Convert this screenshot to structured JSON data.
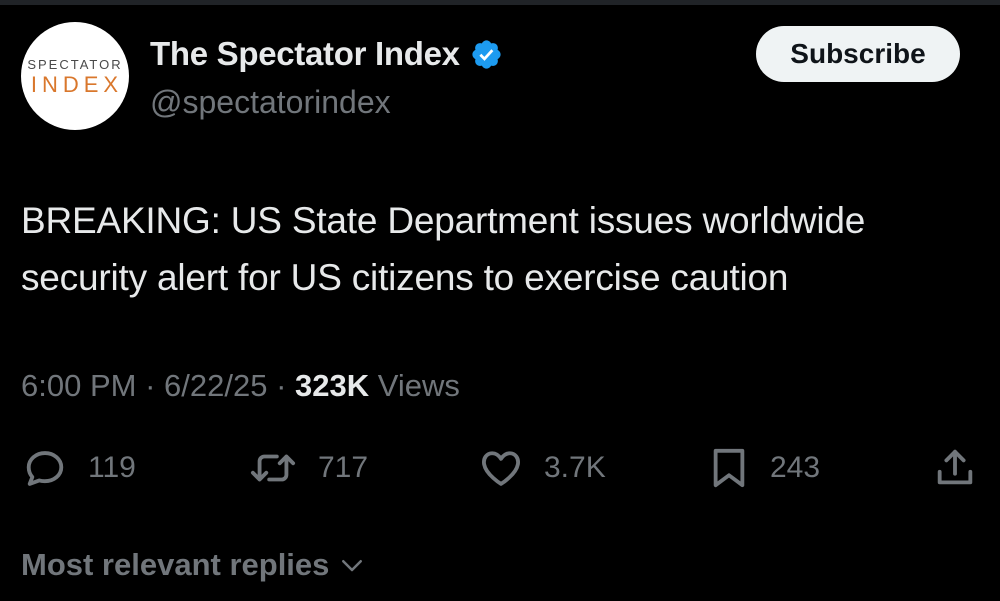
{
  "author": {
    "avatar_line1": "SPECTATOR",
    "avatar_line2": "INDEX",
    "display_name": "The Spectator Index",
    "handle": "@spectatorindex",
    "verified_icon": "verified-badge-icon",
    "verified_color": "#1d9bf0"
  },
  "subscribe_label": "Subscribe",
  "tweet": {
    "text": "BREAKING: US State Department issues worldwide security alert for US citizens to exercise caution"
  },
  "meta": {
    "time": "6:00 PM",
    "separator": " · ",
    "date": "6/22/25",
    "views_count": "323K",
    "views_label": " Views"
  },
  "actions": {
    "replies": {
      "icon": "reply-icon",
      "count": "119"
    },
    "reposts": {
      "icon": "repost-icon",
      "count": "717"
    },
    "likes": {
      "icon": "heart-icon",
      "count": "3.7K"
    },
    "bookmarks": {
      "icon": "bookmark-icon",
      "count": "243"
    },
    "share": {
      "icon": "share-icon"
    }
  },
  "replies_sort": {
    "label": "Most relevant replies",
    "icon": "chevron-down-icon"
  },
  "colors": {
    "background": "#000000",
    "text_primary": "#e7e9ea",
    "text_secondary": "#71767b",
    "accent": "#1d9bf0"
  }
}
